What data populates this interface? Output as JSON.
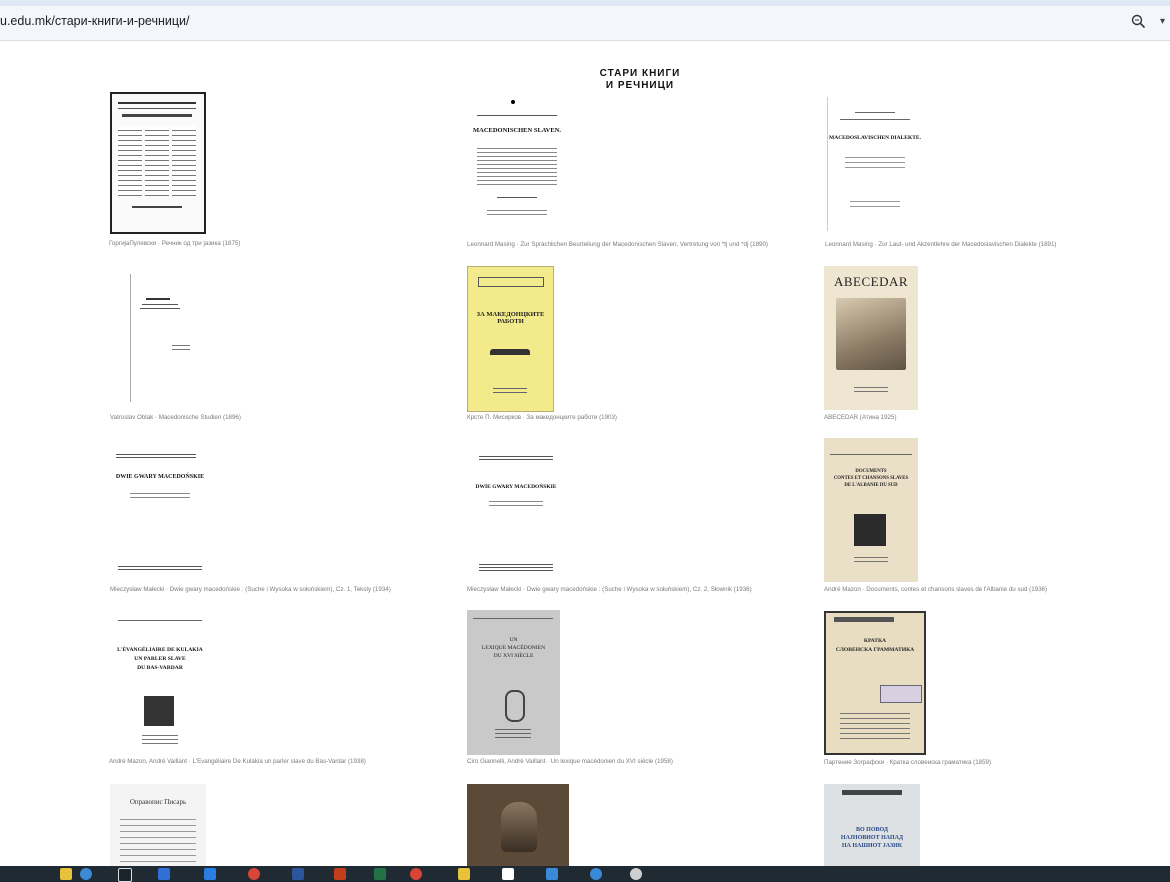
{
  "browser": {
    "url": "u.edu.mk/стари-книги-и-речници/"
  },
  "page": {
    "title_line1": "СТАРИ КНИГИ",
    "title_line2": "И РЕЧНИЦИ"
  },
  "books": [
    {
      "caption": "ГоргијаПулевски · Речник од три јазика (1875)",
      "cover_text": []
    },
    {
      "caption": "Leonnard Masing · Zur Sprachlichen Beurteilung der Macedonischen Slaven, Vertretung von *tj und *dj (1890)",
      "cover_text": [
        "MACEDONISCHEN SLAVEN."
      ]
    },
    {
      "caption": "Leonnard Masing · Zur Laut- und Akzentlehre der Macedoslavischen Dialekte (1891)",
      "cover_text": [
        "MACEDOSLAVISCHEN DIALEKTE."
      ]
    },
    {
      "caption": "Vatroslav Oblak · Macedonische Studien (1896)",
      "cover_text": []
    },
    {
      "caption": "Крсте П. Мисирков · За македонцките работи (1903)",
      "cover_text": [
        "ЗА МАКЕДОНЦКИТЕ РАБОТИ"
      ]
    },
    {
      "caption": "ABECEDAR (Атина 1925)",
      "cover_text": [
        "ABECEDAR"
      ]
    },
    {
      "caption": "Mieczysław Małecki · Dwie gwary macedońskie : (Suche i Wysoka w sołuńskiem), Cz. 1, Teksty (1934)",
      "cover_text": [
        "DWIE GWARY MACEDOŃSKIE"
      ]
    },
    {
      "caption": "Mieczysław Małecki · Dwie gwary macedońskie : (Suche i Wysoka w sołuńskiem), Cz. 2, Słownik (1936)",
      "cover_text": [
        "DWIE GWARY MACEDOŃSKIE"
      ]
    },
    {
      "caption": "André Mazon · Documents, contes et chansons slaves de l'Albanie du sud (1936)",
      "cover_text": [
        "DOCUMENTS",
        "CONTES ET CHANSONS SLAVES",
        "DE L'ALBANIE DU SUD"
      ]
    },
    {
      "caption": "André Mazon, André Vaillant · L'Evangéliaire De Kulakia un parler slave du Bas-Vardar (1938)",
      "cover_text": [
        "L'ÉVANGÉLIAIRE DE KULAKIA",
        "UN PARLER SLAVE",
        "DU BAS-VARDAR"
      ]
    },
    {
      "caption": "Ciro Giannelli, André Vaillant · Un lexique macédonien du XVI siècle (1958)",
      "cover_text": [
        "UN",
        "LEXIQUE MACÉDONIEN",
        "DU XVI SIÈCLE"
      ]
    },
    {
      "caption": "Партение Зографски · Кратка словенска граматика (1859)",
      "cover_text": [
        "КРАТКА",
        "СЛОВЕНСКА ГРАММАТИКА"
      ]
    },
    {
      "caption": "",
      "cover_text": [
        "Оправопис Писарь"
      ]
    },
    {
      "caption": "",
      "cover_text": []
    },
    {
      "caption": "",
      "cover_text": [
        "ВО ПОВОД",
        "НАЈНОВИОТ НАПАД",
        "НА НАШИОТ ЈАЗИК"
      ]
    }
  ],
  "icons": {
    "zoom": "zoom-icon",
    "dropdown": "chevron-down-icon"
  }
}
